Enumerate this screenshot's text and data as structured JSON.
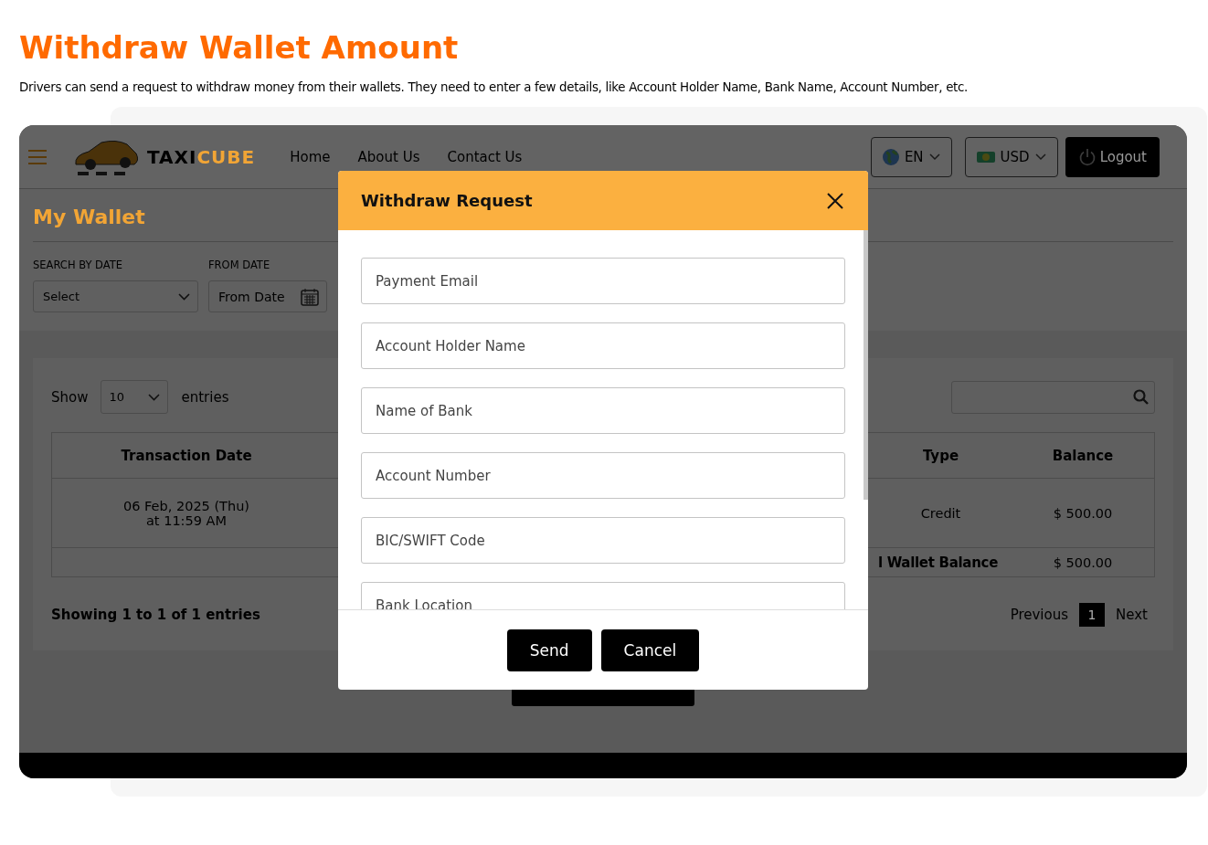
{
  "page": {
    "title": "Withdraw Wallet Amount",
    "description": "Drivers can send a request to withdraw money from their wallets. They need to enter a few details, like Account Holder Name, Bank Name, Account Number, etc."
  },
  "header": {
    "logo": {
      "part_1": "TAXI",
      "part_2": "CUBE"
    },
    "nav": [
      "Home",
      "About Us",
      "Contact Us"
    ],
    "language": "EN",
    "currency": "USD",
    "logout": "Logout"
  },
  "wallet": {
    "title": "My Wallet",
    "filters": [
      {
        "label": "SEARCH BY DATE",
        "kind": "select",
        "value": "Select"
      },
      {
        "label": "FROM DATE",
        "kind": "date",
        "placeholder": "From Date"
      }
    ],
    "show": {
      "before": "Show",
      "value": "10",
      "after": "entries"
    },
    "table": {
      "columns": [
        "Transaction Date",
        "",
        "",
        "Type",
        "Balance"
      ],
      "rows": [
        {
          "cells": [
            "06 Feb, 2025 (Thu)\nat 11:59 AM",
            "",
            "",
            "Credit",
            "$ 500.00"
          ]
        }
      ],
      "total": {
        "label": "l Wallet Balance",
        "value": "$ 500.00"
      }
    },
    "summary": "Showing 1 to 1 of 1 entries",
    "pagination": {
      "previous": "Previous",
      "pages": [
        {
          "label": "1",
          "selected": true
        }
      ],
      "next": "Next"
    }
  },
  "modal": {
    "title": "Withdraw Request",
    "fields": [
      {
        "placeholder": "Payment Email"
      },
      {
        "placeholder": "Account Holder Name"
      },
      {
        "placeholder": "Name of Bank"
      },
      {
        "placeholder": "Account Number"
      },
      {
        "placeholder": "BIC/SWIFT Code"
      },
      {
        "placeholder": "Bank Location"
      }
    ],
    "buttons": [
      "Send",
      "Cancel"
    ]
  }
}
